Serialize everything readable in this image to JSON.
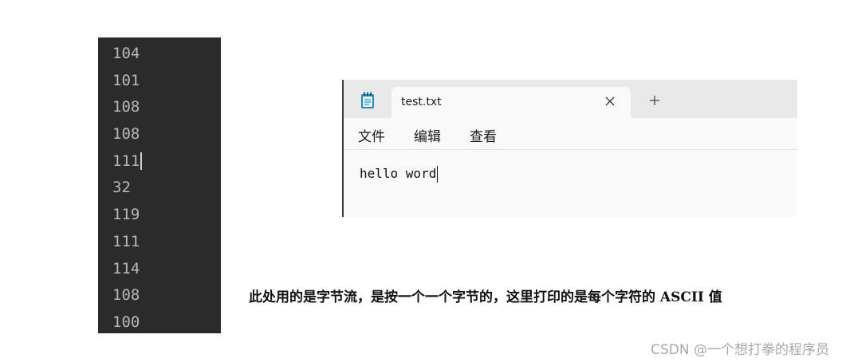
{
  "console": {
    "lines": [
      "104",
      "101",
      "108",
      "108",
      "111",
      "32",
      "119",
      "111",
      "114",
      "108",
      "100"
    ]
  },
  "notepad": {
    "tab_title": "test.txt",
    "menu": [
      "文件",
      "编辑",
      "查看"
    ],
    "content": "hello word"
  },
  "caption": "此处用的是字节流，是按一个一个字节的，这里打印的是每个字符的 ASCII 值",
  "watermark": "CSDN @一个想打拳的程序员",
  "colors": {
    "console_bg": "#2b2b2b",
    "console_text": "#b8b8b8",
    "tabbar_bg": "#e9e9e9",
    "notepad_bg": "#f9f9f9",
    "notepad_icon": "#1d8fbf"
  }
}
